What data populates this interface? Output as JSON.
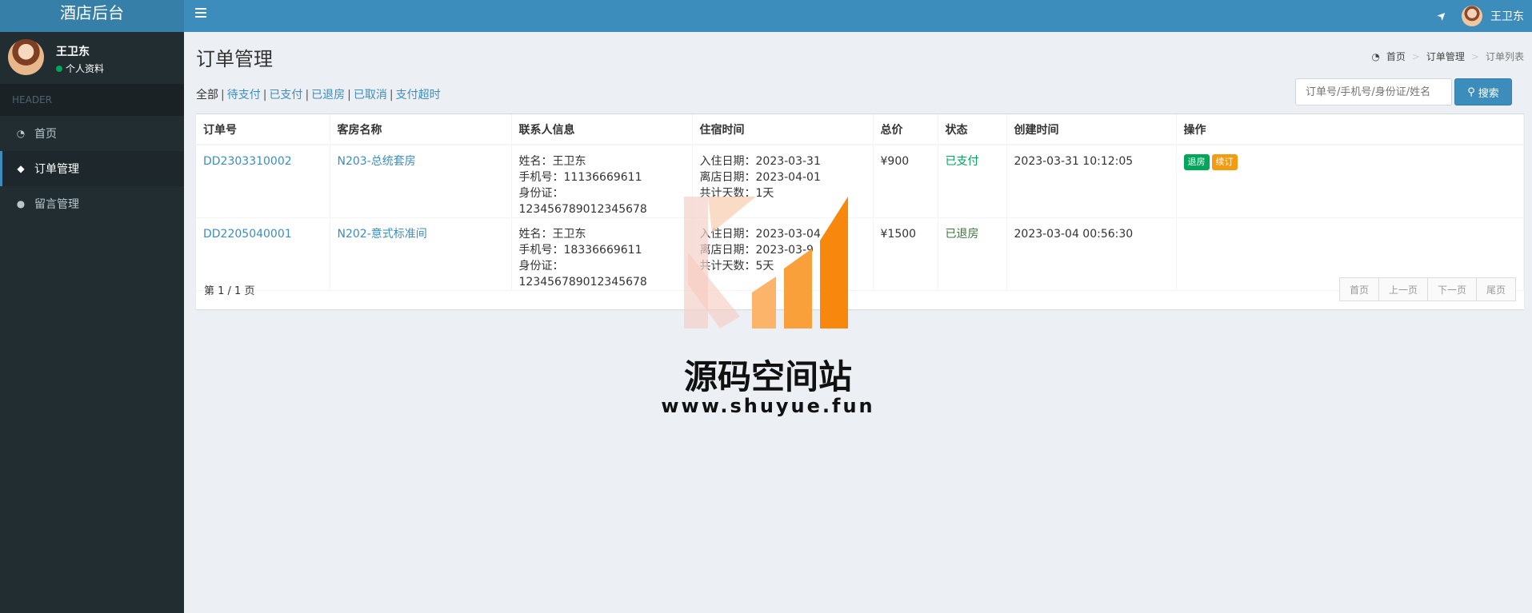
{
  "app": {
    "title": "酒店后台"
  },
  "topbar": {
    "username": "王卫东"
  },
  "sidebar": {
    "user_name": "王卫东",
    "user_status": "个人资料",
    "header": "HEADER",
    "items": [
      {
        "label": "首页",
        "icon": "dashboard-icon"
      },
      {
        "label": "订单管理",
        "icon": "tag-icon"
      },
      {
        "label": "留言管理",
        "icon": "comment-icon"
      }
    ]
  },
  "page": {
    "title": "订单管理",
    "breadcrumb": [
      "首页",
      "订单管理",
      "订单列表"
    ]
  },
  "filters": {
    "items": [
      "全部",
      "待支付",
      "已支付",
      "已退房",
      "已取消",
      "支付超时"
    ]
  },
  "search": {
    "placeholder": "订单号/手机号/身份证/姓名",
    "button": "搜索"
  },
  "table": {
    "headers": [
      "订单号",
      "客房名称",
      "联系人信息",
      "住宿时间",
      "总价",
      "状态",
      "创建时间",
      "操作"
    ],
    "rows": [
      {
        "order_no": "DD2303310002",
        "room": "N203-总统套房",
        "contact": [
          "姓名：王卫东",
          "手机号：11136669611",
          "身份证：123456789012345678"
        ],
        "stay": [
          "入住日期：2023-03-31",
          "离店日期：2023-04-01",
          "共计天数：1天"
        ],
        "price": "¥900",
        "status": "已支付",
        "created": "2023-03-31 10:12:05",
        "actions": [
          "退房",
          "续订"
        ]
      },
      {
        "order_no": "DD2205040001",
        "room": "N202-意式标准间",
        "contact": [
          "姓名：王卫东",
          "手机号：18336669611",
          "身份证：123456789012345678"
        ],
        "stay": [
          "入住日期：2023-03-04",
          "离店日期：2023-03-9",
          "共计天数：5天"
        ],
        "price": "¥1500",
        "status": "已退房",
        "created": "2023-03-04 00:56:30",
        "actions": []
      }
    ]
  },
  "pagination": {
    "info": "第 1 / 1 页",
    "buttons": [
      "首页",
      "上一页",
      "下一页",
      "尾页"
    ]
  },
  "watermark": {
    "title": "源码空间站",
    "url": "www.shuyue.fun"
  }
}
